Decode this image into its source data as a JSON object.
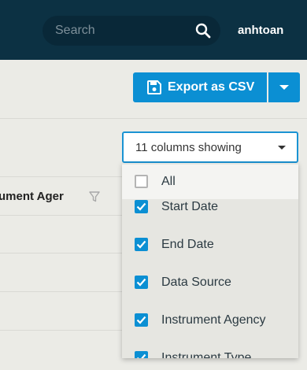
{
  "header": {
    "search_placeholder": "Search",
    "username": "anhtoan"
  },
  "toolbar": {
    "export_label": "Export as CSV"
  },
  "columns_select": {
    "label": "11 columns showing"
  },
  "table": {
    "column_header": "ument Ager"
  },
  "menu": {
    "items": [
      {
        "label": "All",
        "checked": false
      },
      {
        "label": "Start Date",
        "checked": true
      },
      {
        "label": "End Date",
        "checked": true
      },
      {
        "label": "Data Source",
        "checked": true
      },
      {
        "label": "Instrument Agency",
        "checked": true
      },
      {
        "label": "Instrument Type",
        "checked": true
      }
    ]
  },
  "colors": {
    "navy": "#0c3143",
    "accent": "#0b8fd3"
  }
}
